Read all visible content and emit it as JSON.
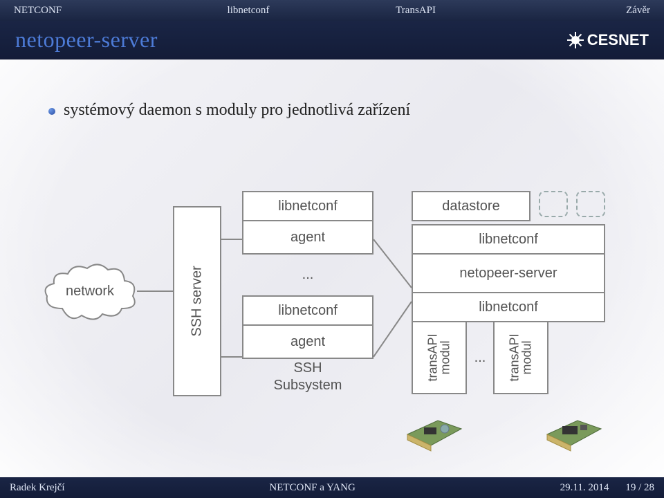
{
  "nav": {
    "items": [
      "NETCONF",
      "libnetconf",
      "TransAPI",
      "Závěr"
    ]
  },
  "header": {
    "title": "netopeer-server",
    "logo_text": "CESNET"
  },
  "bullet": {
    "text": "systémový daemon s moduly pro jednotlivá zařízení"
  },
  "diagram": {
    "cloud_label": "network",
    "ssh_server_label": "SSH server",
    "mid": {
      "lib": "libnetconf",
      "agent": "agent",
      "dots": "...",
      "sshsub1": "SSH",
      "sshsub2": "Subsystem"
    },
    "right": {
      "datastore": "datastore",
      "lib": "libnetconf",
      "nps": "netopeer-server",
      "module_label": "transAPI\nmodul",
      "module_dots": "..."
    }
  },
  "footer": {
    "author": "Radek Krejčí",
    "center": "NETCONF a YANG",
    "date": "29.11. 2014",
    "page": "19 / 28"
  }
}
